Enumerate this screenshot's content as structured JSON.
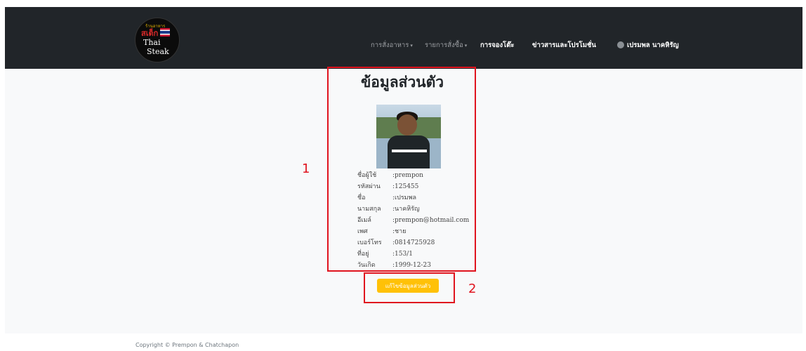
{
  "header": {
    "logo": {
      "small_text": "ร้านอาหาร",
      "brand_thai": "สเต็ก",
      "brand_mark": "ไทย",
      "line1": "Thai",
      "line2": "Steak"
    },
    "nav": [
      {
        "label": "การสั่งอาหาร",
        "has_dropdown": true
      },
      {
        "label": "รายการสั่งซื้อ",
        "has_dropdown": true
      },
      {
        "label": "การจองโต๊ะ",
        "has_dropdown": false
      },
      {
        "label": "ข่าวสารและโปรโมชั่น",
        "has_dropdown": false
      }
    ],
    "user": {
      "name": "เปรมพล นาคหิรัญ",
      "icon": "user-avatar-icon"
    },
    "caret_glyph": "▾"
  },
  "profile": {
    "title": "ข้อมูลส่วนตัว",
    "photo": "profile-photo",
    "fields": [
      {
        "label": "ชื่อผู้ใช้",
        "value": ":prempon"
      },
      {
        "label": "รหัสผ่าน",
        "value": ":125455"
      },
      {
        "label": "ชื่อ",
        "value": ":เปรมพล"
      },
      {
        "label": "นามสกุล",
        "value": ":นาคหิรัญ"
      },
      {
        "label": "อีเมล์",
        "value": ":prempon@hotmail.com"
      },
      {
        "label": "เพศ",
        "value": ":ชาย"
      },
      {
        "label": "เบอร์โทร",
        "value": ":0814725928"
      },
      {
        "label": "ที่อยู่",
        "value": ":153/1"
      },
      {
        "label": "วันเกิด",
        "value": ":1999-12-23"
      }
    ],
    "edit_button": "แก้ไขข้อมูลส่วนตัว"
  },
  "annotations": {
    "box1_number": "1",
    "box2_number": "2",
    "color": "#e0141e"
  },
  "footer": {
    "copyright": "Copyright © Prempon & Chatchapon"
  },
  "colors": {
    "navbar": "#212529",
    "accent": "#ffc107",
    "background": "#f8f9fa"
  }
}
